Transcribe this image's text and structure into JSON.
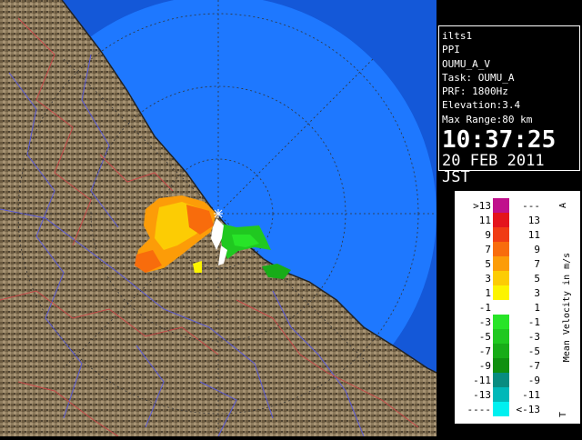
{
  "info": {
    "station": "ilts1",
    "scan": "PPI",
    "product": "OUMU_A_V",
    "task": "Task: OUMU_A",
    "prf": "PRF: 1800Hz",
    "elevation": "Elevation:3.4",
    "max_range": "Max Range:80 km",
    "time": "10:37:25",
    "date": "20 FEB 2011 JST"
  },
  "legend": {
    "axis_label": "Mean Velocity in m/s",
    "top_mark": "A",
    "bottom_mark": "T",
    "rows": [
      {
        "left": ">13",
        "right": "---",
        "color": "#c0108c"
      },
      {
        "left": "11",
        "right": "13",
        "color": "#e4141c"
      },
      {
        "left": "9",
        "right": "11",
        "color": "#f03c14"
      },
      {
        "left": "7",
        "right": "9",
        "color": "#f86c0c"
      },
      {
        "left": "5",
        "right": "7",
        "color": "#fc9c08"
      },
      {
        "left": "3",
        "right": "5",
        "color": "#fccc04"
      },
      {
        "left": "1",
        "right": "3",
        "color": "#fcf400"
      },
      {
        "left": "-1",
        "right": "1",
        "color": "#ffffff"
      },
      {
        "left": "-3",
        "right": "-1",
        "color": "#28e428"
      },
      {
        "left": "-5",
        "right": "-3",
        "color": "#20c820"
      },
      {
        "left": "-7",
        "right": "-5",
        "color": "#18ac18"
      },
      {
        "left": "-9",
        "right": "-7",
        "color": "#109010"
      },
      {
        "left": "-11",
        "right": "-9",
        "color": "#088c80"
      },
      {
        "left": "-13",
        "right": "-11",
        "color": "#00b8b8"
      },
      {
        "left": "----",
        "right": "<-13",
        "color": "#00f0f0"
      }
    ]
  },
  "colors": {
    "sea": "#1e78ff",
    "sea_outer": "#1458d8",
    "land": "#8c7a5c"
  }
}
